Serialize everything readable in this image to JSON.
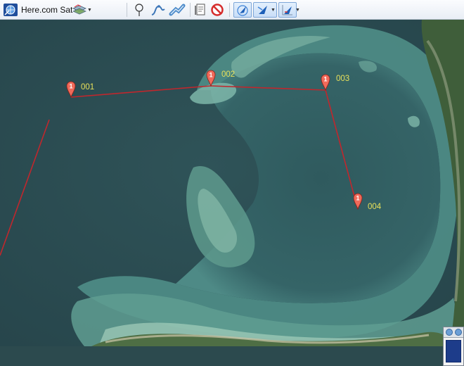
{
  "toolbar": {
    "map_source_label": "Here.com Sat",
    "map_source_icon": "satellite-globe-icon",
    "layers_icon": "layers-icon",
    "tools": [
      "waypoint-pin-icon",
      "route-curve-icon",
      "track-icon",
      "notes-icon",
      "stop-icon",
      "nav-arrow-circle-icon",
      "nav-arrow-icon",
      "nav-arrow-grid-icon"
    ]
  },
  "map": {
    "route_color": "#c0272d",
    "label_color": "#e8e05a",
    "waypoints": [
      {
        "label": "001"
      },
      {
        "label": "002"
      },
      {
        "label": "003"
      },
      {
        "label": "004"
      }
    ]
  }
}
